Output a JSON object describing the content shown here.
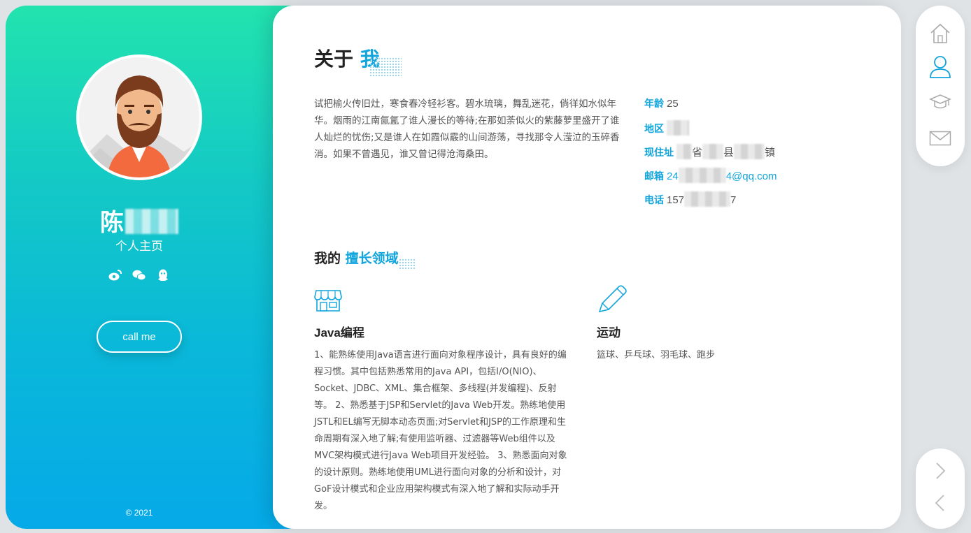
{
  "profile": {
    "name_visible": "陈",
    "subtitle": "个人主页",
    "call_button": "call me",
    "copyright": "© 2021",
    "social_icons": [
      "weibo-icon",
      "wechat-icon",
      "qq-icon"
    ]
  },
  "about": {
    "heading_main": "关于",
    "heading_accent": "我",
    "intro": "试把榆火传旧灶，寒食春冷轻衫客。碧水琉璃，舞乱迷花，倘徉如水似年华。烟雨的江南氤氲了谁人漫长的等待;在那如荼似火的紫藤萝里盛开了谁人灿烂的忧伤;又是谁人在如霞似霰的山间游荡，寻找那令人滢泣的玉碎香消。如果不曾遇见，谁又曾记得沧海桑田。",
    "info": {
      "age_label": "年龄",
      "age_value": "25",
      "region_label": "地区",
      "address_label": "现住址",
      "address_value_parts": [
        "省",
        "县",
        "镇"
      ],
      "email_label": "邮箱",
      "email_prefix": "24",
      "email_suffix": "4@qq.com",
      "phone_label": "电话",
      "phone_prefix": "157",
      "phone_suffix": "7"
    }
  },
  "skills": {
    "heading_main": "我的",
    "heading_accent": "擅长领域",
    "items": [
      {
        "icon": "shop-icon",
        "title": "Java编程",
        "desc": "1、能熟练使用Java语言进行面向对象程序设计，具有良好的编程习惯。其中包括熟悉常用的Java API，包括I/O(NIO)、Socket、JDBC、XML、集合框架、多线程(并发编程)、反射等。 2、熟悉基于JSP和Servlet的Java Web开发。熟练地使用JSTL和EL编写无脚本动态页面;对Servlet和JSP的工作原理和生命周期有深入地了解;有使用监听器、过滤器等Web组件以及MVC架构模式进行Java Web项目开发经验。 3、熟悉面向对象的设计原则。熟练地使用UML进行面向对象的分析和设计，对GoF设计模式和企业应用架构模式有深入地了解和实际动手开发。"
      },
      {
        "icon": "pencil-icon",
        "title": "运动",
        "desc": "篮球、乒乓球、羽毛球、跑步"
      }
    ]
  },
  "nav": {
    "items": [
      "home-icon",
      "user-icon",
      "graduation-cap-icon",
      "mail-icon"
    ],
    "active": "user-icon",
    "pager": [
      "chevron-right-icon",
      "chevron-left-icon"
    ]
  },
  "colors": {
    "accent": "#11a5dc",
    "gradient_top": "#22e3ae",
    "gradient_bottom": "#05a9e8"
  }
}
